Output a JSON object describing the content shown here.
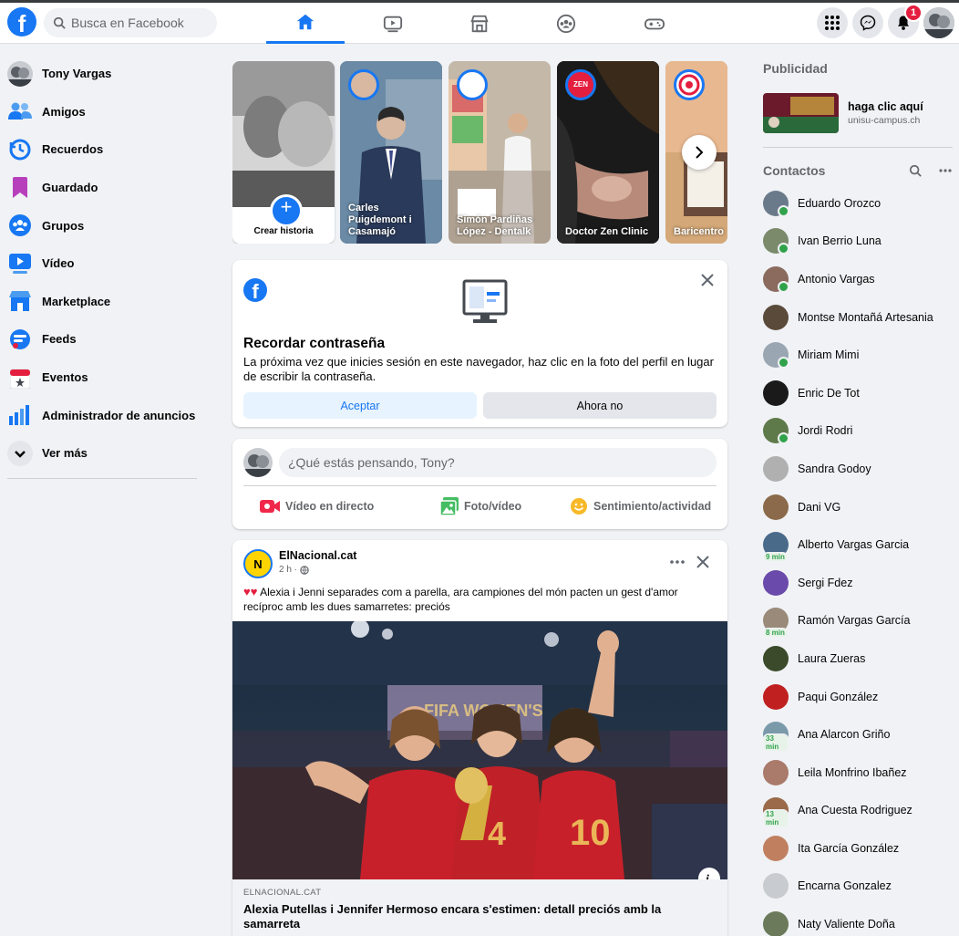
{
  "header": {
    "search_placeholder": "Busca en Facebook",
    "notif_count": "1",
    "nav_tabs": [
      "home-icon",
      "video-icon",
      "marketplace-icon",
      "groups-icon",
      "gaming-icon"
    ],
    "accent": "#1877f2"
  },
  "sidebar": {
    "items": [
      {
        "label": "Tony Vargas",
        "icon": "profile-avatar"
      },
      {
        "label": "Amigos",
        "icon": "friends-icon"
      },
      {
        "label": "Recuerdos",
        "icon": "memories-icon"
      },
      {
        "label": "Guardado",
        "icon": "saved-icon"
      },
      {
        "label": "Grupos",
        "icon": "groups-icon"
      },
      {
        "label": "Vídeo",
        "icon": "video-icon"
      },
      {
        "label": "Marketplace",
        "icon": "marketplace-icon"
      },
      {
        "label": "Feeds",
        "icon": "feeds-icon"
      },
      {
        "label": "Eventos",
        "icon": "events-icon"
      },
      {
        "label": "Administrador de anuncios",
        "icon": "ads-manager-icon"
      },
      {
        "label": "Ver más",
        "icon": "chevron-down-icon"
      }
    ]
  },
  "stories": {
    "create_label": "Crear historia",
    "items": [
      {
        "name": "Carles Puigdemont i Casamajó"
      },
      {
        "name": "Simón Pardiñas López - Dentalk"
      },
      {
        "name": "Doctor Zen Clinic"
      },
      {
        "name": "Baricentro"
      }
    ]
  },
  "password_card": {
    "title": "Recordar contraseña",
    "body": "La próxima vez que inicies sesión en este navegador, haz clic en la foto del perfil en lugar de escribir la contraseña.",
    "accept": "Aceptar",
    "decline": "Ahora no"
  },
  "composer": {
    "placeholder": "¿Qué estás pensando, Tony?",
    "live": "Vídeo en directo",
    "photo": "Foto/vídeo",
    "feeling": "Sentimiento/actividad"
  },
  "post": {
    "page": "ElNacional.cat",
    "time": "2 h ·",
    "text": "Alexia i Jenni separades com a parella, ara campiones del món pacten un gest d'amor recíproc amb les dues samarretes: preciós",
    "link_domain": "ELNACIONAL.CAT",
    "link_title": "Alexia Putellas i Jennifer Hermoso encara s'estimen: detall preciós amb la samarreta"
  },
  "ads": {
    "heading": "Publicidad",
    "title": "haga clic aquí",
    "domain": "unisu-campus.ch"
  },
  "contacts": {
    "heading": "Contactos",
    "items": [
      {
        "name": "Eduardo Orozco",
        "status": "online",
        "color": "#6b7a8a"
      },
      {
        "name": "Ivan Berrio Luna",
        "status": "online",
        "color": "#7a8a6b"
      },
      {
        "name": "Antonio Vargas",
        "status": "online",
        "color": "#8a6b5e"
      },
      {
        "name": "Montse Montañá Artesania",
        "status": "none",
        "color": "#5a4a3a"
      },
      {
        "name": "Miriam Mimi",
        "status": "online",
        "color": "#9aa6b2"
      },
      {
        "name": "Enric De Tot",
        "status": "none",
        "color": "#1a1a1a"
      },
      {
        "name": "Jordi Rodri",
        "status": "online",
        "color": "#5e7a4a"
      },
      {
        "name": "Sandra Godoy",
        "status": "none",
        "color": "#b0b0b0"
      },
      {
        "name": "Dani VG",
        "status": "none",
        "color": "#8a6a4a"
      },
      {
        "name": "Alberto Vargas Garcia",
        "status": "9 min",
        "color": "#4a6a8a"
      },
      {
        "name": "Sergi Fdez",
        "status": "none",
        "color": "#6a4aaa"
      },
      {
        "name": "Ramón Vargas García",
        "status": "8 min",
        "color": "#9a8a7a"
      },
      {
        "name": "Laura Zueras",
        "status": "none",
        "color": "#3a4a2a"
      },
      {
        "name": "Paqui González",
        "status": "none",
        "color": "#c02020"
      },
      {
        "name": "Ana Alarcon Griño",
        "status": "33 min",
        "color": "#7a9aaa"
      },
      {
        "name": "Leila Monfrino Ibañez",
        "status": "none",
        "color": "#aa7a6a"
      },
      {
        "name": "Ana Cuesta Rodriguez",
        "status": "13 min",
        "color": "#9a6a4a"
      },
      {
        "name": "Ita García González",
        "status": "none",
        "color": "#c08060"
      },
      {
        "name": "Encarna Gonzalez",
        "status": "none",
        "color": "#c8ccd0"
      },
      {
        "name": "Naty Valiente Doña",
        "status": "none",
        "color": "#6a7a5a"
      }
    ]
  }
}
